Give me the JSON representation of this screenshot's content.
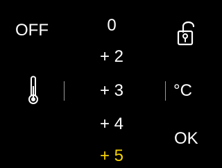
{
  "controls": {
    "off_label": "OFF",
    "ok_label": "OK",
    "unit_label": "°C"
  },
  "values": [
    "0",
    "+ 2",
    "+ 3",
    "+ 4",
    "+ 5"
  ],
  "selected_value": "+ 5",
  "icons": {
    "lock": "unlocked-padlock-icon",
    "temperature": "thermometer-icon"
  },
  "colors": {
    "background": "#000000",
    "text": "#ffffff",
    "selected": "#f6d200",
    "divider": "#9a9a9a"
  }
}
